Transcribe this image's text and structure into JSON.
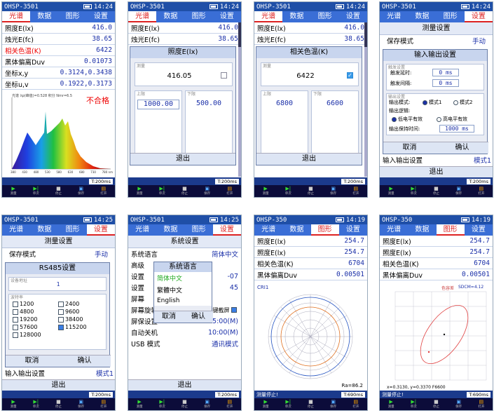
{
  "device_title": "OHSP-3501",
  "device_title_short": "OHSP-350",
  "times": [
    "14:24",
    "14:24",
    "14:24",
    "14:24",
    "14:25",
    "14:25",
    "14:19",
    "14:19"
  ],
  "tabs": [
    "光谱",
    "数据",
    "图形",
    "设置"
  ],
  "footer": {
    "status_left": "",
    "status_stopped": "测量停止!",
    "integration": "T:200ms",
    "integration_2": "T:690ms",
    "buttons": [
      "测量",
      "单次",
      "停止",
      "保存",
      "打开"
    ]
  },
  "panel1": {
    "rows": [
      {
        "k": "照度E(lx)",
        "v": "416.0"
      },
      {
        "k": "烛光E(fc)",
        "v": "38.65"
      },
      {
        "k": "相关色温(K)",
        "v": "6422"
      },
      {
        "k": "黑体偏离Duv",
        "v": "0.01073"
      },
      {
        "k": "坐标x,y",
        "v": "0.3124,0.3438"
      },
      {
        "k": "坐标u,v",
        "v": "0.1922,0.3173"
      }
    ],
    "spectrum_note": "光谱 λp(峰值)=0.528 积分 Nmr=6.5",
    "fail": "不合格",
    "x_ticks": [
      "380",
      "430",
      "480",
      "530",
      "580",
      "630",
      "680",
      "730",
      "780 nm"
    ]
  },
  "panel2": {
    "rows": [
      {
        "k": "照度E(lx)",
        "v": "416.0"
      },
      {
        "k": "烛光E(fc)",
        "v": "38.65"
      }
    ],
    "dialog_title": "照度E(lx)",
    "measure_label": "测量",
    "measure_value": "416.05",
    "upper_label": "上限",
    "upper_value": "1000.00",
    "lower_label": "下限",
    "lower_value": "500.00",
    "exit": "退出"
  },
  "panel3": {
    "rows": [
      {
        "k": "照度E(lx)",
        "v": "416.0"
      },
      {
        "k": "烛光E(fc)",
        "v": "38.65"
      }
    ],
    "dialog_title": "相关色温(K)",
    "measure_label": "测量",
    "measure_value": "6422",
    "upper_label": "上限",
    "upper_value": "6800",
    "lower_label": "下限",
    "lower_value": "6600",
    "exit": "退出"
  },
  "panel4": {
    "head": "测量设置",
    "save_mode_k": "保存模式",
    "save_mode_v": "手动",
    "io_head": "输入输出设置",
    "input_group": "触发设置",
    "trig_delay": "触发延时:",
    "trig_delay_v": "0 ms",
    "trig_hold": "触发间隔:",
    "trig_hold_v": "0 ms",
    "output_group": "输出设置",
    "out_mode": "输出模式:",
    "mode1": "模式1",
    "mode2": "模式2",
    "out_logic": "输出逻辑:",
    "low_eff": "低电平有效",
    "high_eff": "高电平有效",
    "out_hold": "输出保持时间:",
    "out_hold_v": "1000 ms",
    "cancel": "取消",
    "ok": "确认",
    "io_set_k": "输入输出设置",
    "io_set_v": "模式1",
    "exit": "退出"
  },
  "panel5": {
    "head": "测量设置",
    "save_mode_k": "保存模式",
    "save_mode_v": "手动",
    "rs_head": "RS485设置",
    "addr_label": "设备地址",
    "addr_value": "1",
    "baud_label": "波特率",
    "bauds": [
      "1200",
      "2400",
      "4800",
      "9600",
      "19200",
      "38400",
      "57600",
      "115200",
      "128000"
    ],
    "cancel": "取消",
    "ok": "确认",
    "io_set_k": "输入输出设置",
    "io_set_v": "模式1",
    "exit": "退出"
  },
  "panel6": {
    "head": "系统设置",
    "lang_k": "系统语言",
    "lang_v": "简体中文",
    "hi_k": "高级",
    "set_k1": "设置",
    "set_v1": "-07",
    "set_k2": "设置",
    "set_v2": "45",
    "screen_k": "屏幕",
    "rotate_k": "屏幕旋转",
    "key_shot": "按键截屏",
    "saver_k": "屏保设置",
    "saver_v": "05:00(M)",
    "auto_off_k": "自动关机",
    "auto_off_v": "10:00(M)",
    "usb_k": "USB 模式",
    "usb_v": "通讯模式",
    "popup_title": "系统语言",
    "langs": [
      "简体中文",
      "繁體中文",
      "English"
    ],
    "cancel": "取消",
    "ok": "确认",
    "exit": "退出"
  },
  "panel7": {
    "rows": [
      {
        "k": "照度E(lx)",
        "v": "254.7"
      },
      {
        "k": "照度E(lx)",
        "v": "254.7"
      },
      {
        "k": "相关色温(K)",
        "v": "6704"
      },
      {
        "k": "黑体偏离Duv",
        "v": "0.00501"
      }
    ],
    "chart_label": "CRI1",
    "ra": "Ra=86.2"
  },
  "panel8": {
    "rows": [
      {
        "k": "照度E(lx)",
        "v": "254.7"
      },
      {
        "k": "照度E(lx)",
        "v": "254.7"
      },
      {
        "k": "相关色温(K)",
        "v": "6704"
      },
      {
        "k": "黑体偏离Duv",
        "v": "0.00501"
      }
    ],
    "chart_label": "色容差",
    "sdcm": "SDCM=4.12",
    "coord": "x=0.3130, y=0.3370 F6600"
  }
}
